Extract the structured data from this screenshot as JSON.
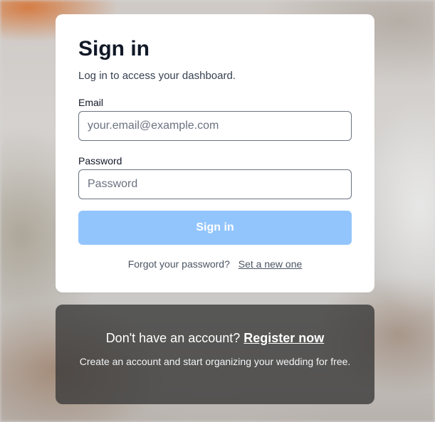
{
  "signin": {
    "title": "Sign in",
    "subtitle": "Log in to access your dashboard.",
    "email_label": "Email",
    "email_placeholder": "your.email@example.com",
    "email_value": "",
    "password_label": "Password",
    "password_placeholder": "Password",
    "password_value": "",
    "submit_label": "Sign in",
    "forgot_text": "Forgot your password?",
    "forgot_link": "Set a new one"
  },
  "register": {
    "prompt": "Don't have an account?",
    "link": "Register now",
    "description": "Create an account and start organizing your wedding for free."
  },
  "colors": {
    "button_disabled": "#93c5fd",
    "card_background": "#ffffff",
    "overlay_background": "rgba(55,55,55,0.78)"
  }
}
